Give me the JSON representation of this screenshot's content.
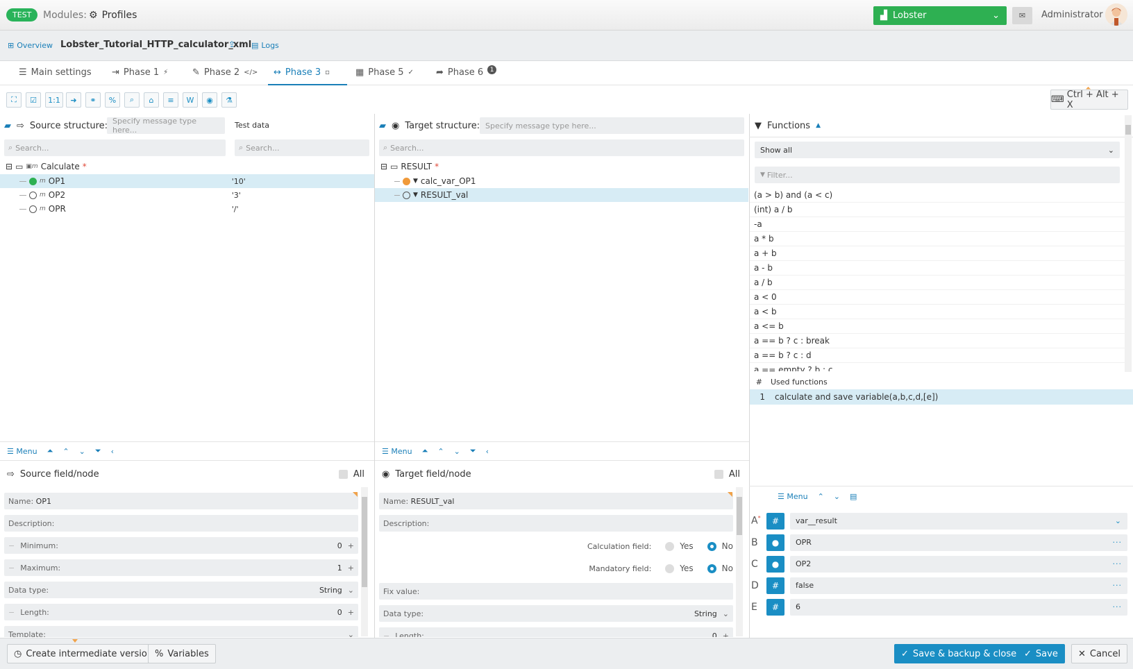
{
  "topbar": {
    "badge": "TEST",
    "modules_label": "Modules:",
    "profiles_label": "Profiles",
    "env_select": "Lobster",
    "user": "Administrator"
  },
  "subbar": {
    "overview": "Overview",
    "profile_name": "Lobster_Tutorial_HTTP_calculator_xml",
    "logs": "Logs"
  },
  "tabs": [
    {
      "label": "Main settings",
      "mark": ""
    },
    {
      "label": "Phase 1",
      "mark": "⚡"
    },
    {
      "label": "Phase 2",
      "mark": "</>"
    },
    {
      "label": "Phase 3",
      "mark": "▫"
    },
    {
      "label": "Phase 5",
      "mark": "✓"
    },
    {
      "label": "Phase 6",
      "mark": "1"
    }
  ],
  "toolbar": {
    "one_to_one": "1:1",
    "shortcut": "Ctrl + Alt + X"
  },
  "source": {
    "title": "Source structure:",
    "type_placeholder": "Specify message type here...",
    "test_data": "Test data",
    "search_placeholder": "Search...",
    "test_search_placeholder": "Search...",
    "root": "Calculate",
    "rows": [
      {
        "name": "OP1",
        "value": "'10'"
      },
      {
        "name": "OP2",
        "value": "'3'"
      },
      {
        "name": "OPR",
        "value": "'/'"
      }
    ]
  },
  "target": {
    "title": "Target structure:",
    "type_placeholder": "Specify message type here...",
    "search_placeholder": "Search...",
    "root": "RESULT",
    "rows": [
      {
        "name": "calc_var_OP1"
      },
      {
        "name": "RESULT_val"
      }
    ]
  },
  "functions": {
    "title": "Functions",
    "filter_select": "Show all",
    "filter_placeholder": "Filter...",
    "list": [
      "(a > b) and (a < c)",
      "(int) a / b",
      "-a",
      "a * b",
      "a + b",
      "a - b",
      "a / b",
      "a < 0",
      "a < b",
      "a <= b",
      "a == b ? c : break",
      "a == b ? c : d",
      "a == empty ? b : c"
    ],
    "used_header_num": "#",
    "used_header": "Used functions",
    "used": [
      {
        "num": "1",
        "name": "calculate and save variable(a,b,c,d,[e])"
      }
    ]
  },
  "menu_label": "Menu",
  "source_panel": {
    "title": "Source field/node",
    "all": "All",
    "name_label": "Name:",
    "name_value": "OP1",
    "description": "Description:",
    "minimum_label": "Minimum:",
    "minimum_value": "0",
    "maximum_label": "Maximum:",
    "maximum_value": "1",
    "datatype_label": "Data type:",
    "datatype_value": "String",
    "length_label": "Length:",
    "length_value": "0",
    "template_label": "Template:"
  },
  "target_panel": {
    "title": "Target field/node",
    "all": "All",
    "name_label": "Name:",
    "name_value": "RESULT_val",
    "description": "Description:",
    "calc_label": "Calculation field:",
    "mandatory_label": "Mandatory field:",
    "yes": "Yes",
    "no": "No",
    "fix_label": "Fix value:",
    "datatype_label": "Data type:",
    "datatype_value": "String",
    "length_label": "Length:",
    "length_value": "0"
  },
  "args": [
    {
      "letter": "A",
      "icon": "#",
      "value": "var__result"
    },
    {
      "letter": "B",
      "icon": "●",
      "value": "OPR"
    },
    {
      "letter": "C",
      "icon": "●",
      "value": "OP2"
    },
    {
      "letter": "D",
      "icon": "#",
      "value": "false"
    },
    {
      "letter": "E",
      "icon": "#",
      "value": "6"
    }
  ],
  "footer": {
    "create": "Create intermediate version",
    "variables": "Variables",
    "save_backup": "Save & backup & close",
    "save": "Save",
    "cancel": "Cancel"
  }
}
